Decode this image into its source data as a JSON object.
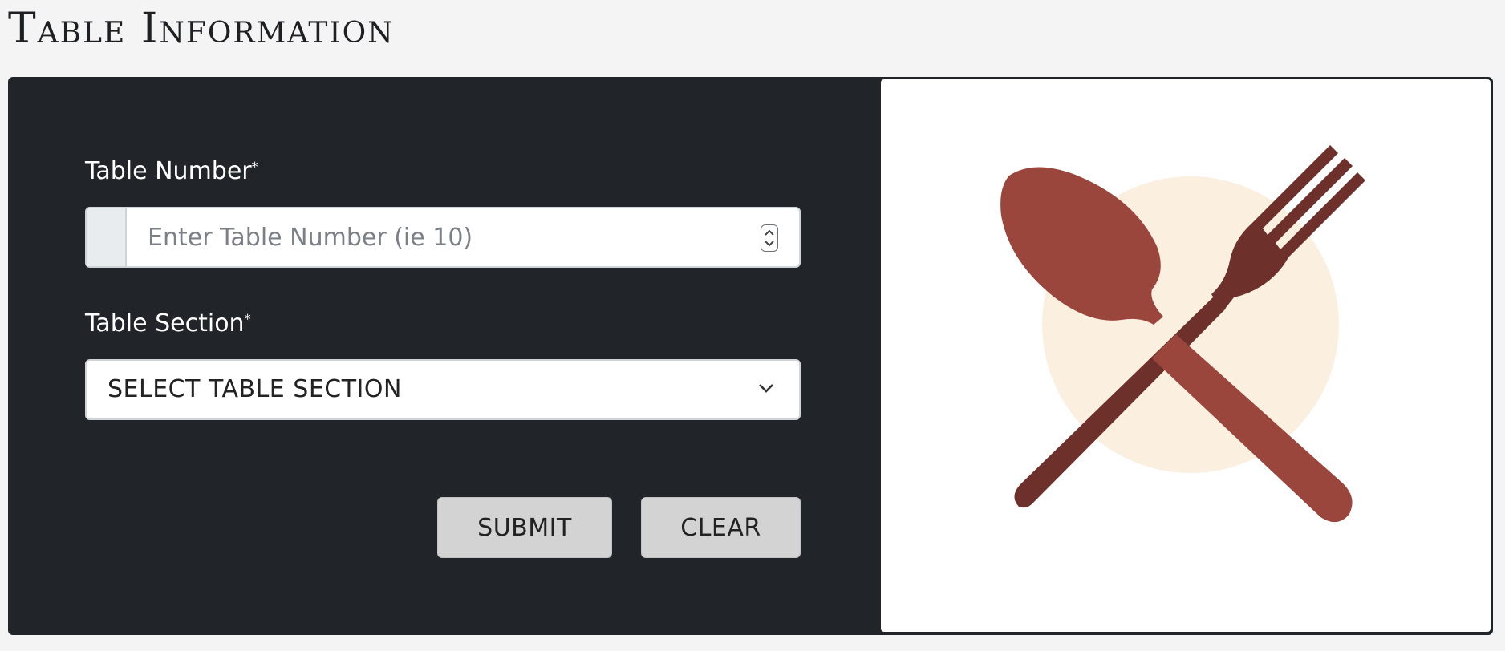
{
  "page": {
    "title": "Table Information"
  },
  "form": {
    "table_number": {
      "label": "Table Number",
      "required_mark": "*",
      "value": "",
      "placeholder": "Enter Table Number (ie 10)"
    },
    "table_section": {
      "label": "Table Section",
      "required_mark": "*",
      "selected": "SELECT TABLE SECTION"
    },
    "buttons": {
      "submit_label": "SUBMIT",
      "clear_label": "CLEAR"
    }
  },
  "illustration": {
    "icon": "spoon-and-fork-icon",
    "colors": {
      "plate": "#fbefe0",
      "spoon": "#9b463d",
      "fork": "#6e302b"
    }
  },
  "colors": {
    "card_background": "#212428",
    "button_background": "#d3d3d3",
    "page_background": "#f4f4f4"
  }
}
